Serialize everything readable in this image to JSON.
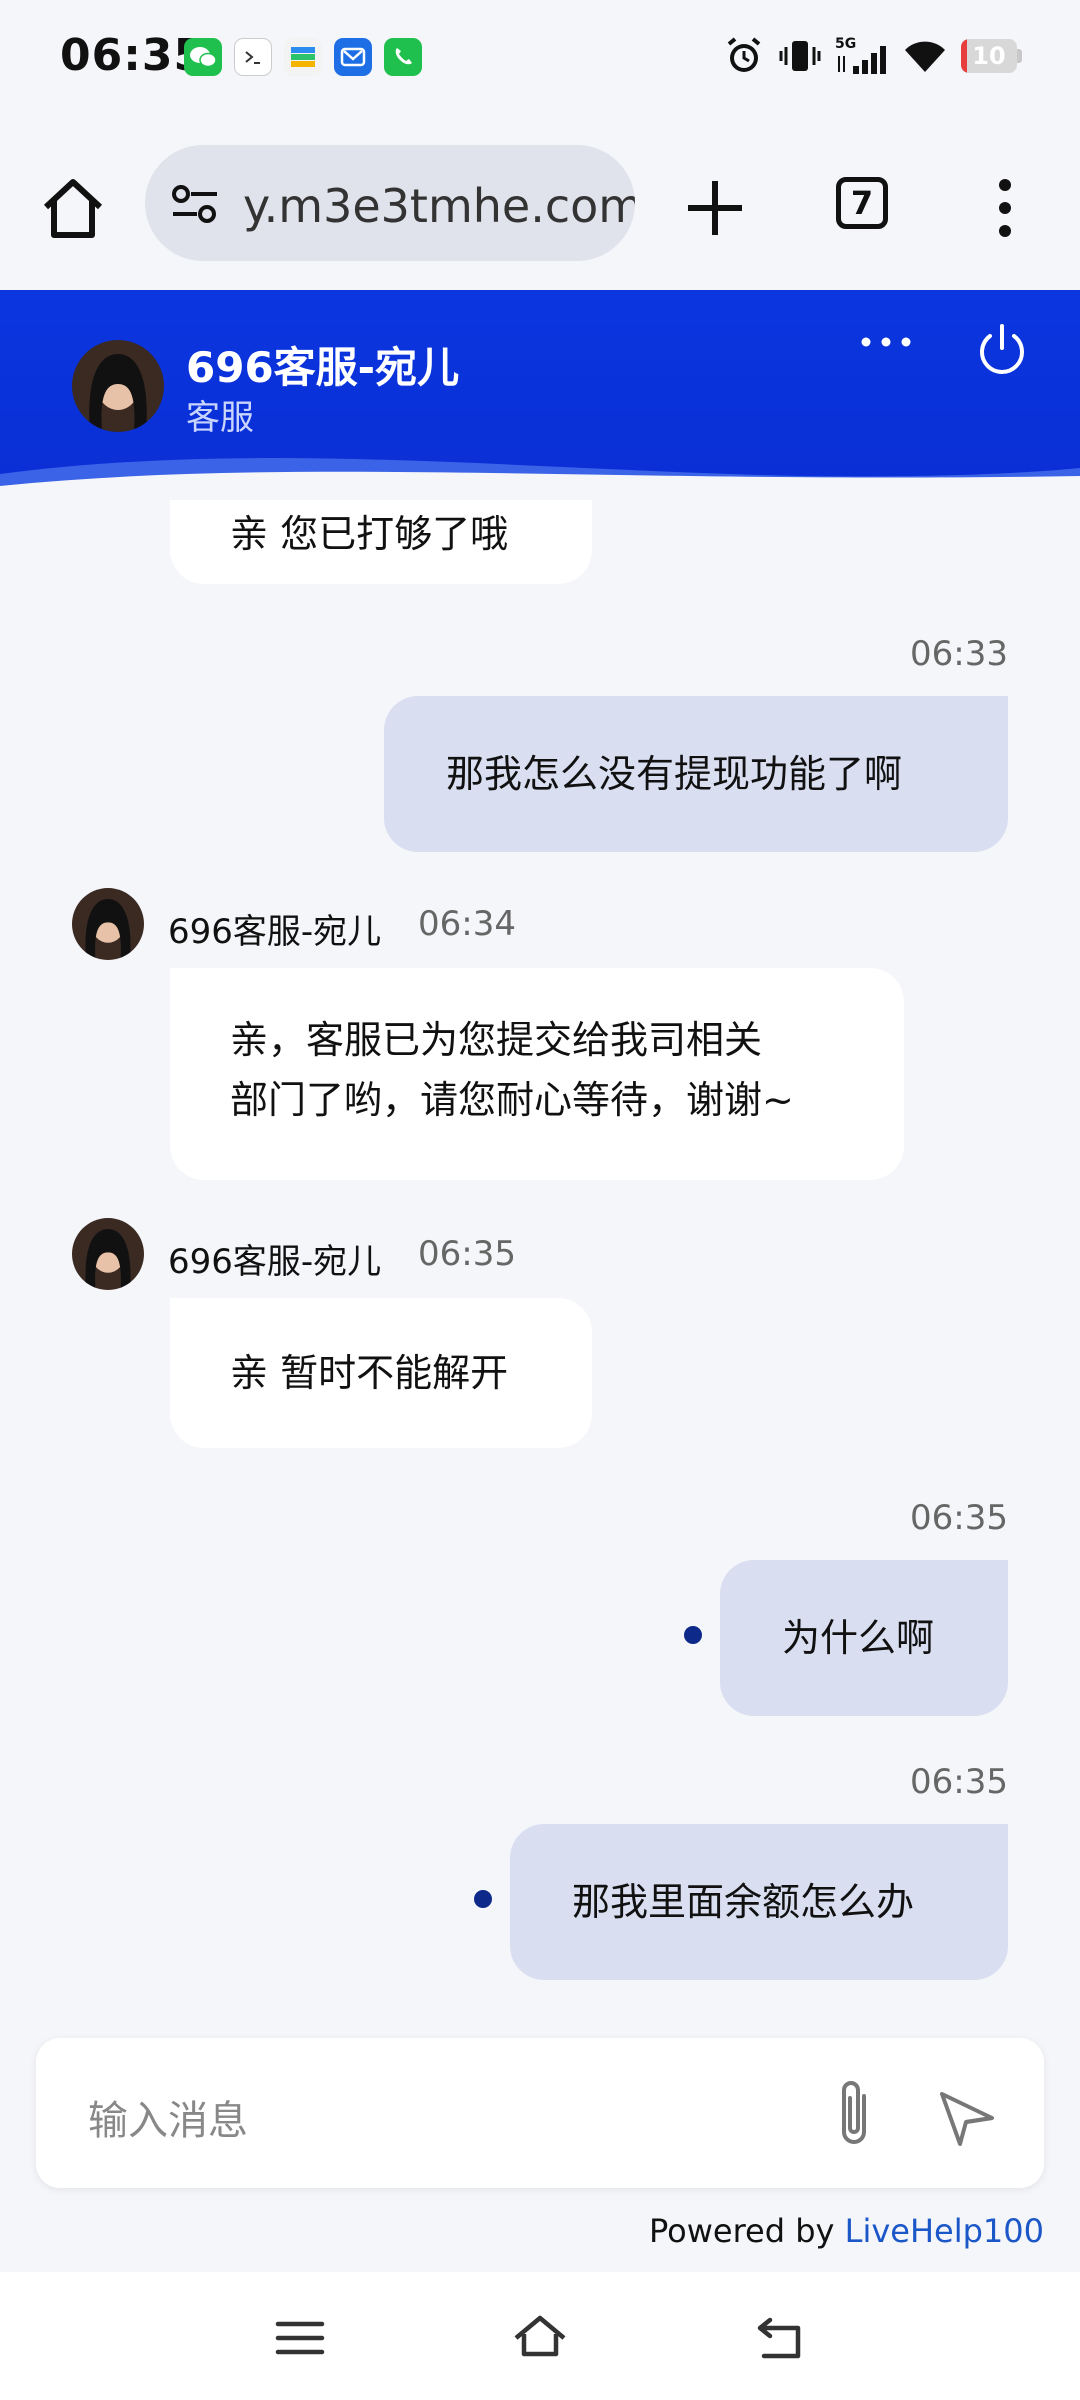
{
  "status": {
    "time": "06:35",
    "network": "5G",
    "battery": 10
  },
  "browser": {
    "url": "y.m3e3tmhe.com",
    "tab_count": "7"
  },
  "chat": {
    "agent_name": "696客服-宛儿",
    "agent_role": "客服",
    "colors": {
      "header": "#0a2ed4",
      "outgoing": "#d9dff1",
      "incoming": "#ffffff",
      "dot": "#0d2a8a"
    },
    "messages": [
      {
        "from": "agent",
        "text": "亲 您已打够了哦"
      },
      {
        "from": "user",
        "time": "06:33",
        "text": "那我怎么没有提现功能了啊"
      },
      {
        "from": "agent",
        "name": "696客服-宛儿",
        "time": "06:34",
        "lines": [
          "亲，客服已为您提交给我司相关",
          "部门了哟，请您耐心等待，谢谢~"
        ]
      },
      {
        "from": "agent",
        "name": "696客服-宛儿",
        "time": "06:35",
        "text": "亲 暂时不能解开"
      },
      {
        "from": "user",
        "time": "06:35",
        "text": "为什么啊"
      },
      {
        "from": "user",
        "time": "06:35",
        "text": "那我里面余额怎么办"
      }
    ],
    "input_placeholder": "输入消息",
    "powered_prefix": "Powered by ",
    "powered_brand": "LiveHelp100"
  },
  "icons": [
    "wechat-icon",
    "terminal-icon",
    "wallet-icon",
    "mail-icon",
    "phone-icon",
    "alarm-icon",
    "vibrate-icon",
    "signal-icon",
    "wifi-icon",
    "home-icon",
    "site-settings-icon",
    "plus-icon",
    "more-vert-icon",
    "more-horiz-icon",
    "power-icon",
    "paperclip-icon",
    "send-icon",
    "menu-icon",
    "back-icon"
  ]
}
